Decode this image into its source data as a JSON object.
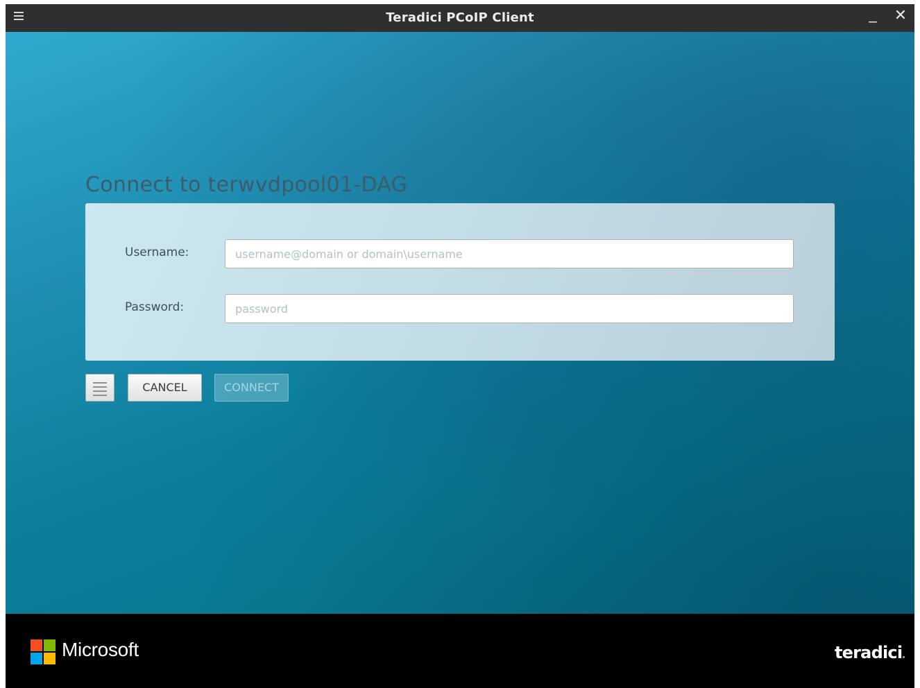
{
  "window": {
    "title": "Teradici PCoIP Client",
    "menu_icon": "hamburger-icon",
    "minimize_symbol": "_",
    "close_symbol": "✕"
  },
  "connect": {
    "heading": "Connect to terwvdpool01-DAG",
    "username_label": "Username:",
    "username_value": "",
    "username_placeholder": "username@domain or domain\\username",
    "password_label": "Password:",
    "password_value": "",
    "password_placeholder": "password"
  },
  "buttons": {
    "options_icon": "hamburger-icon",
    "cancel_label": "CANCEL",
    "connect_label": "CONNECT"
  },
  "footer": {
    "microsoft_text": "Microsoft",
    "teradici_text": "teradici"
  },
  "colors": {
    "titlebar": "#2e2f30",
    "background_top": "#2fa9cf",
    "background_bottom": "#09687f",
    "heading": "#3c5c6a",
    "footer": "#000000"
  }
}
